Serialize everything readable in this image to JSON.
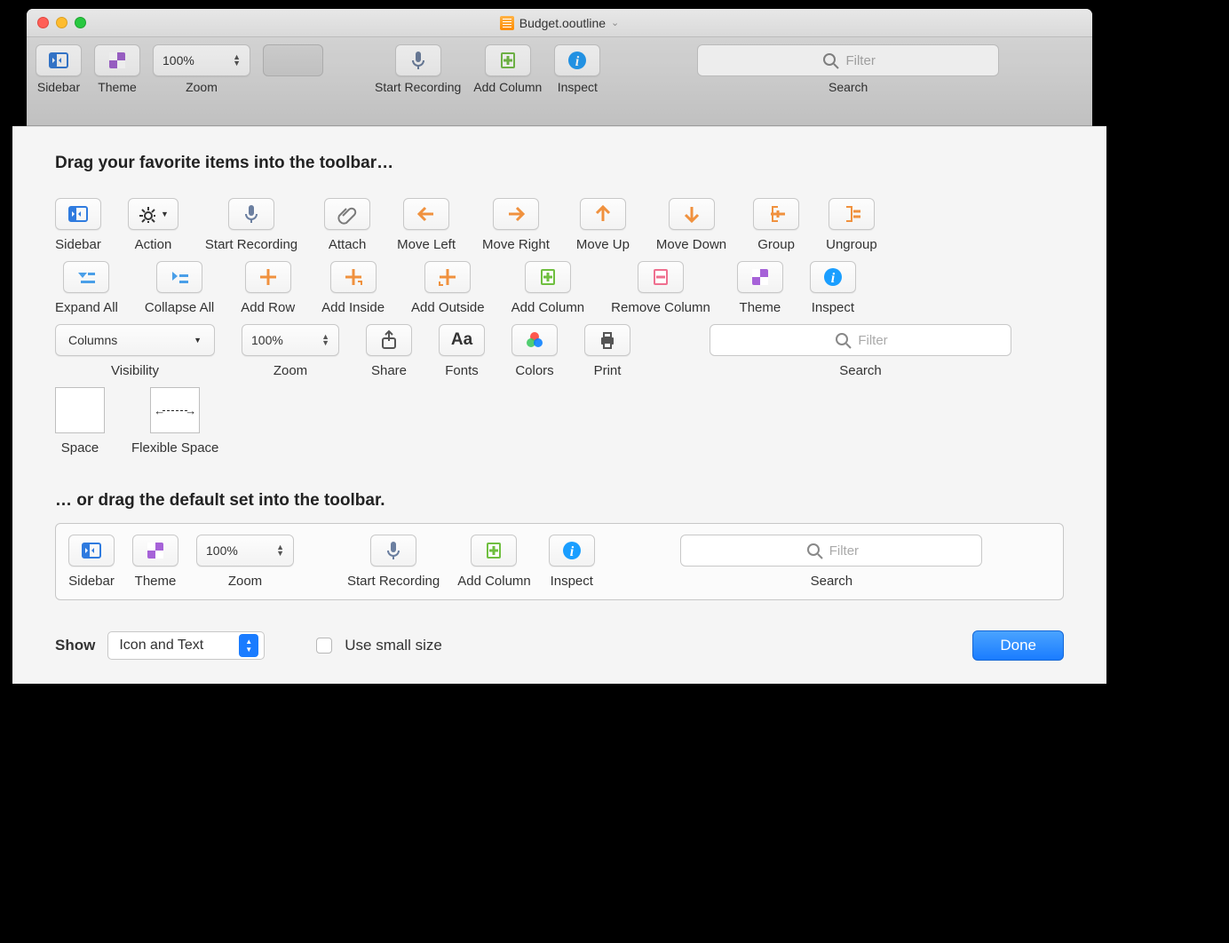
{
  "window": {
    "title": "Budget.ooutline"
  },
  "toolbar": {
    "sidebar": "Sidebar",
    "theme": "Theme",
    "zoom_label": "Zoom",
    "zoom_value": "100%",
    "start_recording": "Start Recording",
    "add_column": "Add Column",
    "inspect": "Inspect",
    "search_label": "Search",
    "search_placeholder": "Filter"
  },
  "sheet": {
    "heading": "Drag your favorite items into the toolbar…",
    "subheading": "… or drag the default set into the toolbar.",
    "items": {
      "sidebar": "Sidebar",
      "action": "Action",
      "start_recording": "Start Recording",
      "attach": "Attach",
      "move_left": "Move Left",
      "move_right": "Move Right",
      "move_up": "Move Up",
      "move_down": "Move Down",
      "group": "Group",
      "ungroup": "Ungroup",
      "expand_all": "Expand All",
      "collapse_all": "Collapse All",
      "add_row": "Add Row",
      "add_inside": "Add Inside",
      "add_outside": "Add Outside",
      "add_column": "Add Column",
      "remove_column": "Remove Column",
      "theme": "Theme",
      "inspect": "Inspect",
      "visibility_label": "Visibility",
      "visibility_value": "Columns",
      "zoom_label": "Zoom",
      "zoom_value": "100%",
      "share": "Share",
      "fonts": "Fonts",
      "colors": "Colors",
      "print": "Print",
      "search_label": "Search",
      "search_placeholder": "Filter",
      "space": "Space",
      "flexible_space": "Flexible Space"
    },
    "default_set": {
      "sidebar": "Sidebar",
      "theme": "Theme",
      "zoom_label": "Zoom",
      "zoom_value": "100%",
      "start_recording": "Start Recording",
      "add_column": "Add Column",
      "inspect": "Inspect",
      "search_label": "Search",
      "search_placeholder": "Filter"
    }
  },
  "footer": {
    "show_label": "Show",
    "show_value": "Icon and Text",
    "small_size": "Use small size",
    "done": "Done"
  }
}
